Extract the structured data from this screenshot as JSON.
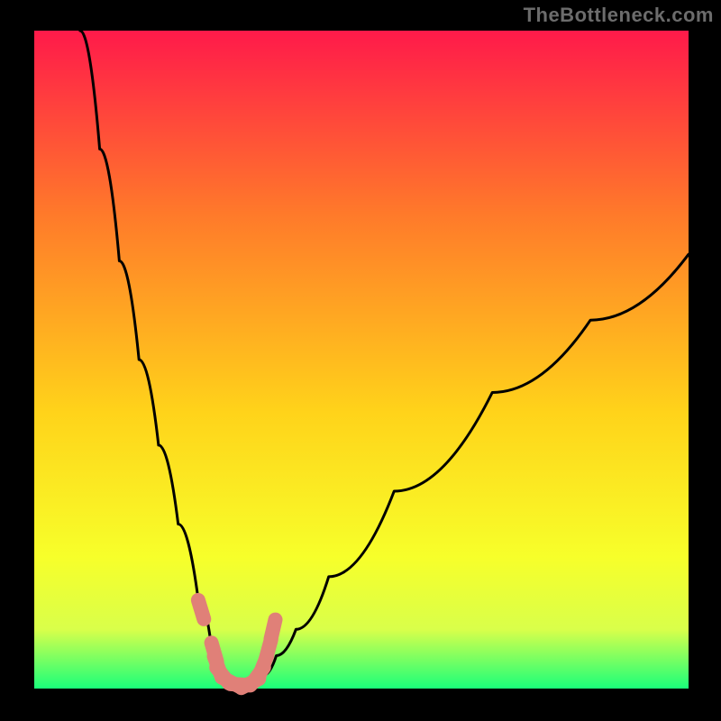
{
  "attribution": "TheBottleneck.com",
  "chart_data": {
    "type": "line",
    "title": "",
    "xlabel": "",
    "ylabel": "",
    "xlim": [
      0,
      100
    ],
    "ylim": [
      0,
      100
    ],
    "background_gradient": {
      "top": "#ff1a4a",
      "upper_mid": "#ff7a2a",
      "mid": "#ffd31a",
      "lower_mid": "#f7ff2a",
      "bottom_band": "#d9ff4a",
      "bottom": "#1aff7a"
    },
    "curve": {
      "description": "Bottleneck percentage curve; steep descent from left, flat minimum near x≈31, shallower ascent to right",
      "x": [
        7,
        10,
        13,
        16,
        19,
        22,
        25,
        27,
        29,
        31,
        33,
        35,
        37,
        40,
        45,
        55,
        70,
        85,
        100
      ],
      "y": [
        100,
        82,
        65,
        50,
        37,
        25,
        14,
        7,
        2,
        0.5,
        0.5,
        2,
        5,
        9,
        17,
        30,
        45,
        56,
        66
      ]
    },
    "markers": {
      "description": "Salmon dots and pill segments marking the region near the minimum",
      "color": "#e08078",
      "x": [
        25.5,
        27.5,
        28.0,
        28.8,
        30.0,
        31.5,
        33.0,
        34.2,
        35.0,
        35.8,
        36.5
      ],
      "y": [
        12.0,
        5.5,
        3.5,
        2.0,
        1.0,
        0.6,
        0.8,
        2.0,
        3.5,
        6.0,
        9.0
      ]
    }
  }
}
